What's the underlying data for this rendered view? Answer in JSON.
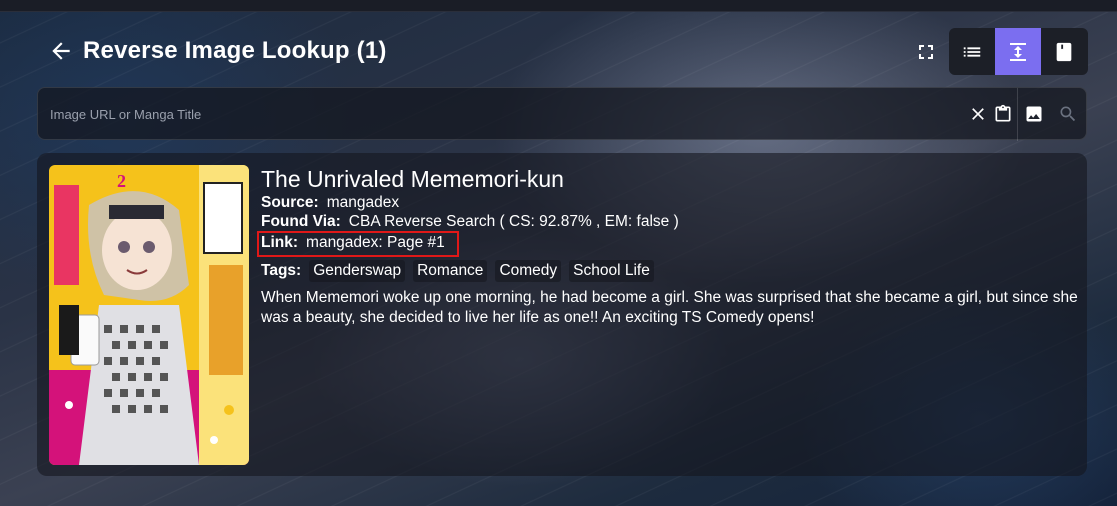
{
  "header": {
    "title": "Reverse Image Lookup (1)"
  },
  "search": {
    "placeholder": "Image URL or Manga Title",
    "value": ""
  },
  "result": {
    "title": "The Unrivaled Mememori-kun",
    "source_label": "Source:",
    "source_value": "mangadex",
    "found_via_label": "Found Via:",
    "found_via_value": "CBA Reverse Search ( CS: 92.87% , EM: false )",
    "link_label": "Link:",
    "link_value": "mangadex: Page #1",
    "tags_label": "Tags:",
    "tags": [
      "Genderswap",
      "Romance",
      "Comedy",
      "School Life"
    ],
    "description": "When Mememori woke up one morning, he had become a girl. She was surprised that she became a girl, but since she was a beauty, she decided to live her life as one!! An exciting TS Comedy opens!",
    "cover_volume": "2"
  },
  "colors": {
    "accent": "#7b6ef0",
    "highlight": "#e01818",
    "cover_yellow": "#f5c21b",
    "cover_magenta": "#d4127a"
  },
  "icons": {
    "back": "arrow-left-icon",
    "fullscreen": "fullscreen-icon",
    "list_view": "list-icon",
    "vertical_view": "vertical-expand-icon",
    "book_view": "book-icon",
    "clear": "close-icon",
    "paste": "clipboard-icon",
    "image": "image-icon",
    "search": "search-icon"
  }
}
